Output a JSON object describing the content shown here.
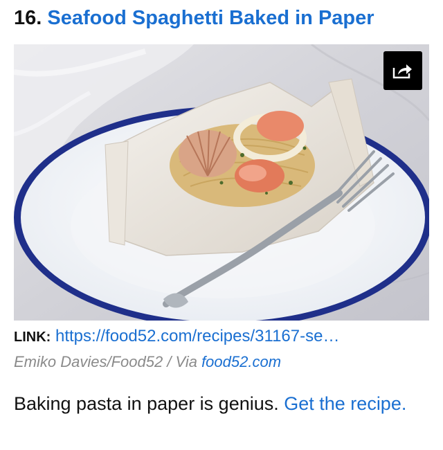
{
  "item": {
    "number": "16.",
    "title": "Seafood Spaghetti Baked in Paper",
    "share_icon": "share-icon",
    "link_label": "LINK:",
    "link_url": "https://food52.com/recipes/31167-se…",
    "credit_text": "Emiko Davies/Food52 / Via ",
    "credit_link": "food52.com",
    "description": "Baking pasta in paper is genius. ",
    "description_link": "Get the recipe."
  },
  "colors": {
    "link": "#1a6fd1",
    "text": "#111111",
    "credit": "#8a8a8a",
    "plate_rim": "#1f2f8a",
    "share_bg": "#000000"
  }
}
